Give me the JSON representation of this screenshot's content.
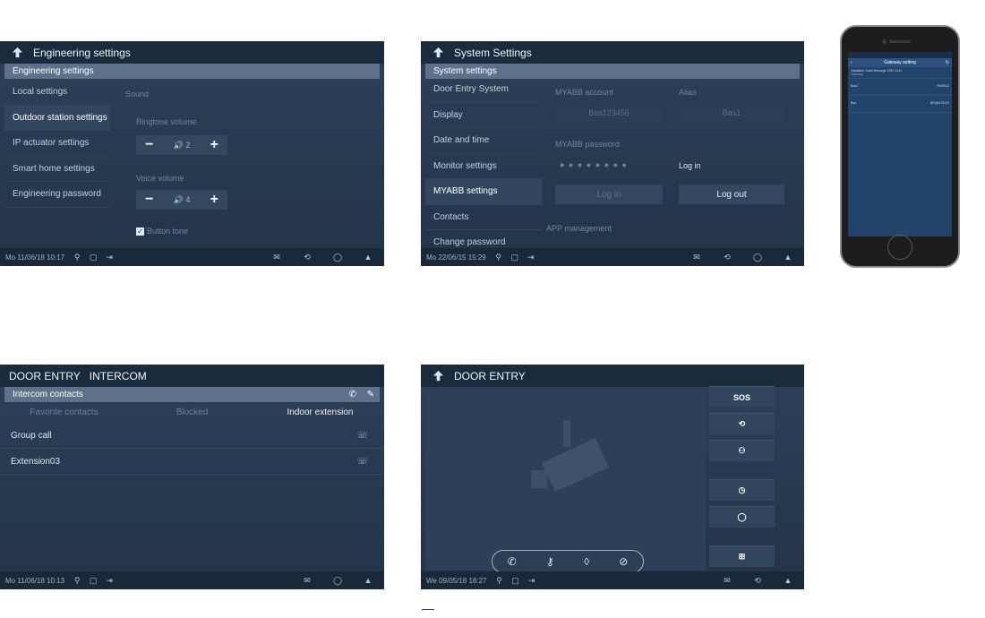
{
  "panel1": {
    "title": "Engineering settings",
    "subtitle": "Engineering settings",
    "menu": [
      "Local settings",
      "Outdoor station settings",
      "IP actuator settings",
      "Smart home settings",
      "Engineering password"
    ],
    "selected_index": 1,
    "sound_label": "Sound",
    "ringtone_label": "Ringtone volume",
    "ringtone_value": "2",
    "voice_label": "Voice volume",
    "voice_value": "4",
    "button_tone_label": "Button tone",
    "button_tone_checked": true,
    "minus": "−",
    "plus": "+",
    "status_time": "Mo 11/06/18  10:17"
  },
  "panel2": {
    "title": "System Settings",
    "subtitle": "System settings",
    "menu": [
      "Door Entry System",
      "Display",
      "Date and time",
      "Monitor settings",
      "MYABB settings",
      "Contacts",
      "Change password"
    ],
    "selected_index": 4,
    "myabb_account_label": "MYABB account",
    "alias_label": "Alias",
    "account_value": "Bas123456",
    "alias_value": "Bas1",
    "password_label": "MYABB password",
    "password_value": "● ● ● ● ● ● ● ●",
    "login_status": "Log in",
    "login_button": "Log in",
    "logout_button": "Log out",
    "app_management": "APP management",
    "status_time": "Mo 22/06/15  15:29"
  },
  "phone": {
    "header": "Gateway setting",
    "row1": "Validation Code Message   1357 2141",
    "row1_sub": "Gateway",
    "row2_label": "Bas4",
    "row2_value": "PAHBD2",
    "row3_label": "Bas",
    "row3_value": "BEQ6478123"
  },
  "panel3": {
    "title_a": "DOOR ENTRY",
    "title_b": "INTERCOM",
    "subtitle": "Intercom contacts",
    "tabs": [
      "Favorite contacts",
      "Blocked",
      "Indoor extension"
    ],
    "active_tab": 2,
    "rows": [
      "Group call",
      "Extension03"
    ],
    "status_time": "Mo 11/06/18  10:13"
  },
  "panel4": {
    "title": "DOOR ENTRY",
    "sos_label": "SOS",
    "status_time": "We 09/05/18  18:27"
  },
  "colors": {
    "panel_bg": "#2d4058",
    "title_bar": "#1b2b3e",
    "subtitle_bar": "#5d728a",
    "status_bar": "#1a293a"
  }
}
